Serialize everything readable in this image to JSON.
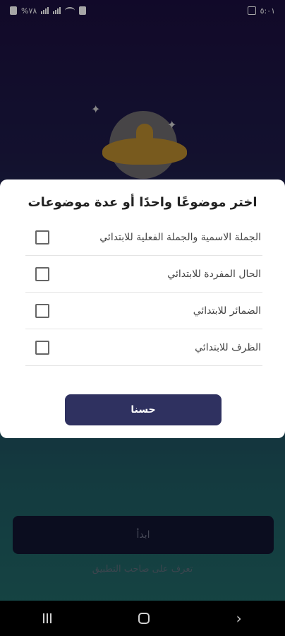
{
  "status_bar": {
    "time": "٥:٠١",
    "left_text": "%٧٨"
  },
  "dialog": {
    "title": "اختر موضوعًا واحدًا أو عدة موضوعات",
    "items": [
      {
        "label": "الجملة الاسمية والجملة الفعلية للابتدائي",
        "checked": false
      },
      {
        "label": "الحال المفردة للابتدائي",
        "checked": false
      },
      {
        "label": "الضمائر للابتدائي",
        "checked": false
      },
      {
        "label": "الظرف للابتدائي",
        "checked": false
      },
      {
        "label": "",
        "checked": false
      }
    ],
    "ok_label": "حسنا"
  },
  "main": {
    "start_label": "ابدأ",
    "about_label": "تعرف على صاحب التطبيق"
  },
  "icons": {
    "back": "back-icon",
    "home": "home-icon",
    "recents": "recents-icon"
  }
}
